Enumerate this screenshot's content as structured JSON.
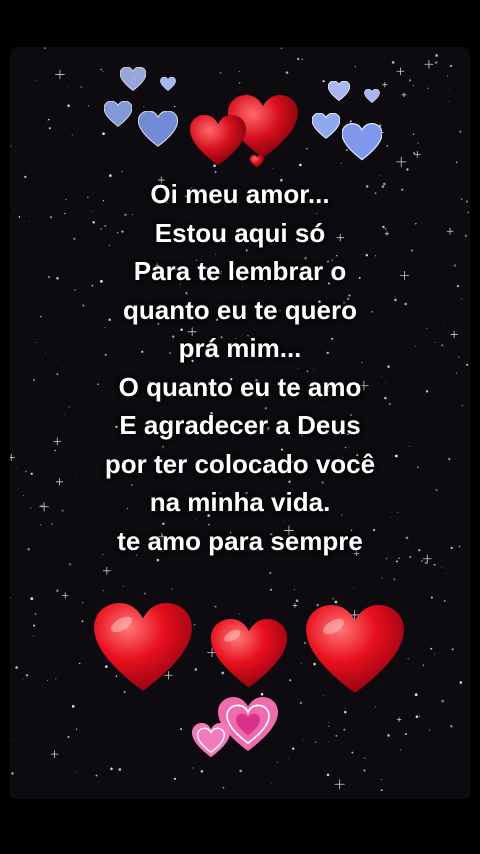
{
  "message": {
    "lines": [
      "Oi meu amor...",
      "Estou aqui só",
      "Para te lembrar o",
      "quanto eu te quero",
      "prá mim...",
      "O quanto eu te amo",
      "E agradecer a Deus",
      "por ter colocado você",
      "na minha vida.",
      "te amo para sempre"
    ]
  },
  "colors": {
    "background": "#0d0b0f",
    "text": "#ffffff",
    "heart_red": "#e8101e",
    "heart_blue": "#9fb3ef",
    "heart_pink": "#f27bb9"
  },
  "decorations": {
    "top_hearts_icon": "heart-icon-cluster",
    "bottom_hearts_icon": "heart-icon",
    "small_pink_hearts_icon": "heart-icon-pink"
  }
}
